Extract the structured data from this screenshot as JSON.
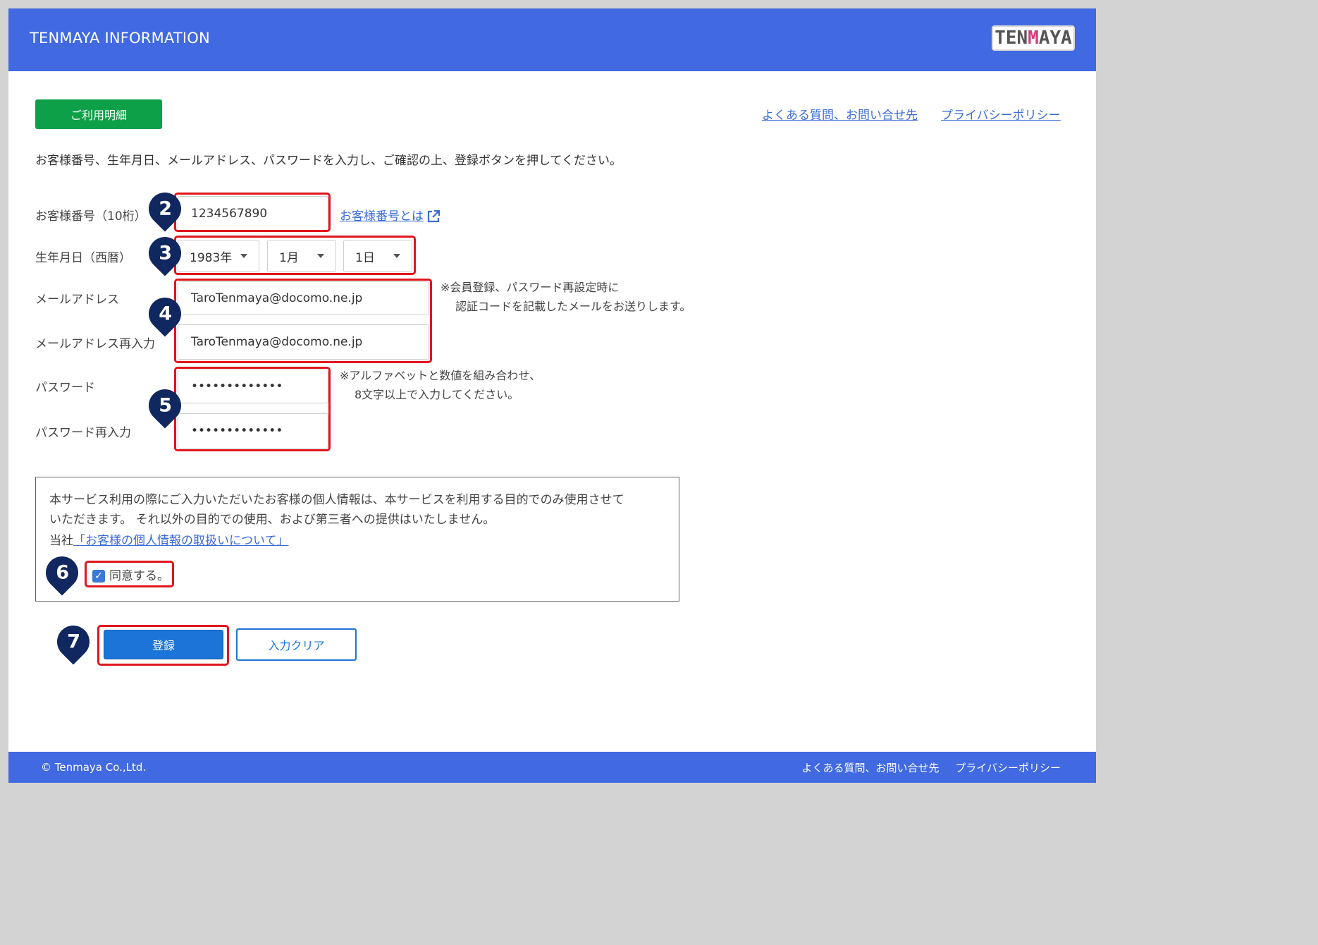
{
  "header": {
    "title": "TENMAYA INFORMATION",
    "logo_text_a": "TEN",
    "logo_text_m": "M",
    "logo_text_b": "AYA"
  },
  "nav": {
    "usage_button": "ご利用明細",
    "faq_link": "よくある質問、お問い合せ先",
    "privacy_link": "プライバシーポリシー"
  },
  "instruction": "お客様番号、生年月日、メールアドレス、パスワードを入力し、ご確認の上、登録ボタンを押してください。",
  "form": {
    "customer_number": {
      "label": "お客様番号（10桁）",
      "value": "1234567890",
      "help_link": "お客様番号とは"
    },
    "birthdate": {
      "label": "生年月日（西暦）",
      "year": "1983年",
      "month": "1月",
      "day": "1日"
    },
    "email": {
      "label": "メールアドレス",
      "value": "TaroTenmaya@docomo.ne.jp"
    },
    "email_confirm": {
      "label": "メールアドレス再入力",
      "value": "TaroTenmaya@docomo.ne.jp"
    },
    "email_note_line1": "※会員登録、パスワード再設定時に",
    "email_note_line2": "認証コードを記載したメールをお送りします。",
    "password": {
      "label": "パスワード",
      "value": "•••••••••••••"
    },
    "password_confirm": {
      "label": "パスワード再入力",
      "value": "•••••••••••••"
    },
    "password_note_line1": "※アルファベットと数値を組み合わせ、",
    "password_note_line2": "8文字以上で入力してください。"
  },
  "consent": {
    "line1": "本サービス利用の際にご入力いただいたお客様の個人情報は、本サービスを利用する目的でのみ使用させて",
    "line2": "いただきます。 それ以外の目的での使用、および第三者への提供はいたしません。",
    "company_prefix": "当社",
    "policy_link": "「お客様の個人情報の取扱いについて」",
    "agree_label": "同意する。",
    "agree_checked": true
  },
  "buttons": {
    "register": "登録",
    "clear": "入力クリア"
  },
  "markers": {
    "m2": "2",
    "m3": "3",
    "m4": "4",
    "m5": "5",
    "m6": "6",
    "m7": "7"
  },
  "footer": {
    "copyright": "© Tenmaya Co.,Ltd.",
    "faq": "よくある質問、お問い合せ先",
    "privacy": "プライバシーポリシー"
  },
  "colors": {
    "header": "#4169e1",
    "green_button": "#0da048",
    "primary_button": "#1c74d9",
    "highlight": "#e0161d",
    "marker": "#10285f"
  }
}
